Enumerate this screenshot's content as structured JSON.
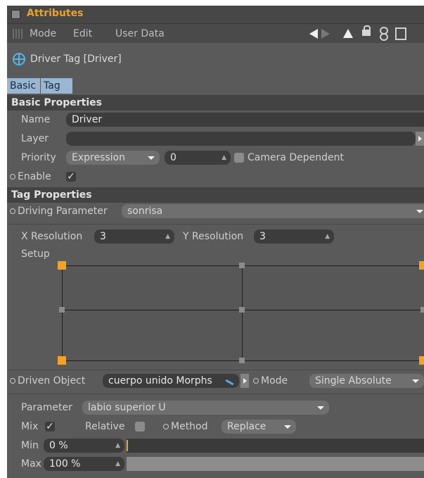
{
  "titlebar": {
    "title": "Attributes"
  },
  "menubar": {
    "items": [
      "Mode",
      "Edit",
      "User Data"
    ],
    "icons": [
      "grip-icon",
      "arrow-left-icon",
      "arrow-right-icon",
      "arrow-up-icon",
      "lock-icon",
      "link-icon",
      "new-window-icon"
    ]
  },
  "tag_header": {
    "title": "Driver Tag [Driver]",
    "icon": "steering-wheel-icon"
  },
  "tabs": [
    "Basic",
    "Tag"
  ],
  "basic_properties": {
    "section_title": "Basic Properties",
    "name_label": "Name",
    "name_value": "Driver",
    "layer_label": "Layer",
    "layer_value": "",
    "priority_label": "Priority",
    "priority_value": "Expression",
    "priority_number": "0",
    "camera_dependent_label": "Camera Dependent",
    "camera_dependent_checked": false,
    "enable_label": "Enable",
    "enable_checked": true
  },
  "tag_properties": {
    "section_title": "Tag Properties",
    "driving_parameter_label": "Driving Parameter",
    "driving_parameter_value": "sonrisa",
    "x_resolution_label": "X Resolution",
    "x_resolution_value": "3",
    "y_resolution_label": "Y Resolution",
    "y_resolution_value": "3",
    "setup_label": "Setup",
    "driven_object_label": "Driven Object",
    "driven_object_value": "cuerpo unido Morphs",
    "mode_label": "Mode",
    "mode_value": "Single Absolute",
    "parameter_label": "Parameter",
    "parameter_value": "labio superior U",
    "mix_label": "Mix",
    "mix_checked": true,
    "relative_label": "Relative",
    "relative_checked": false,
    "method_label": "Method",
    "method_value": "Replace",
    "min_label": "Min",
    "min_value": "0 %",
    "min_fraction": 0.0,
    "max_label": "Max",
    "max_value": "100 %",
    "max_fraction": 1.0
  },
  "colors": {
    "accent_orange": "#f6a21f",
    "tab_blue": "#99b6d3",
    "icon_blue": "#4db6ee",
    "panel_bg": "#5a5a5a",
    "section_bg": "#434343"
  },
  "checkmark_glyph": "✓"
}
